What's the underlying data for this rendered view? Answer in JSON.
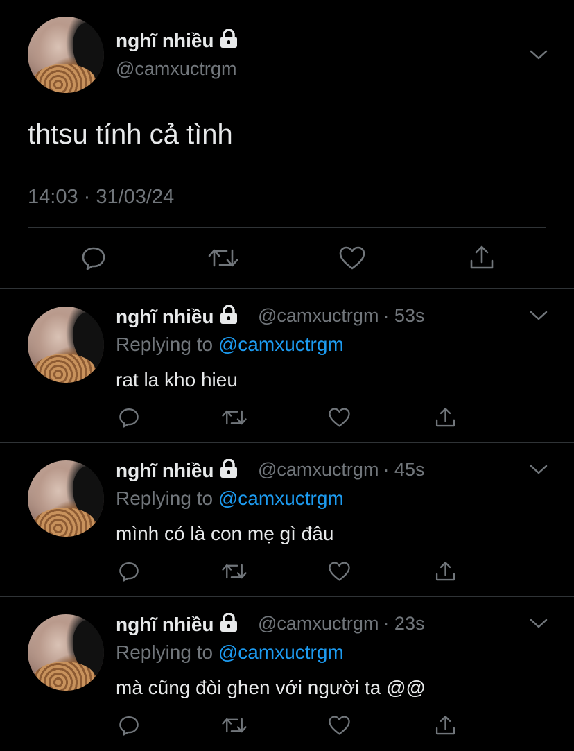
{
  "main_tweet": {
    "author": "nghĩ nhiều",
    "handle": "@camxuctrgm",
    "text": "thtsu tính cả tình",
    "timestamp": "14:03 · 31/03/24"
  },
  "replies": [
    {
      "author": "nghĩ nhiều",
      "handle": "@camxuctrgm",
      "time": "· 53s",
      "replying_prefix": "Replying to ",
      "replying_to": "@camxuctrgm",
      "text": "rat la kho hieu"
    },
    {
      "author": "nghĩ nhiều",
      "handle": "@camxuctrgm",
      "time": "· 45s",
      "replying_prefix": "Replying to ",
      "replying_to": "@camxuctrgm",
      "text": "mình có là con mẹ gì đâu"
    },
    {
      "author": "nghĩ nhiều",
      "handle": "@camxuctrgm",
      "time": "· 23s",
      "replying_prefix": "Replying to ",
      "replying_to": "@camxuctrgm",
      "text": "mà cũng đòi ghen với người ta @@"
    }
  ],
  "icons": [
    "lock-icon",
    "chevron-down-icon",
    "reply-icon",
    "retweet-icon",
    "like-icon",
    "share-icon"
  ],
  "colors": {
    "background": "#000000",
    "text": "#e7e9ea",
    "muted": "#71767b",
    "link": "#1d9bf0",
    "divider": "#2f3336"
  }
}
